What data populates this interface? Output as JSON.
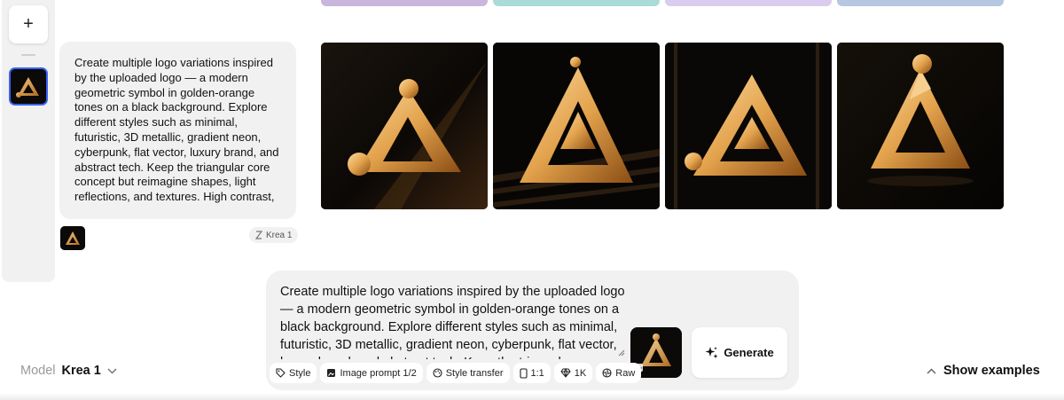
{
  "rail": {
    "add_label": "+"
  },
  "top_strips": [
    {
      "color": "#c9b6dd"
    },
    {
      "color": "#a9dcd6"
    },
    {
      "color": "#d9ccee"
    },
    {
      "color": "#b6c7e1"
    }
  ],
  "prompt": {
    "text": "Create multiple logo variations inspired by the uploaded logo — a modern geometric symbol in golden-orange tones on a black background. Explore different styles such as minimal, futuristic, 3D metallic, gradient neon, cyberpunk, flat vector, luxury brand, and abstract tech. Keep the triangular core concept but reimagine shapes, light reflections, and textures. High contrast,",
    "model_tag": "Krea 1"
  },
  "results": [
    {
      "name": "result-image-1"
    },
    {
      "name": "result-image-2"
    },
    {
      "name": "result-image-3"
    },
    {
      "name": "result-image-4"
    }
  ],
  "composer": {
    "text": "Create multiple logo variations inspired by the uploaded logo — a modern geometric symbol in golden-orange tones on a black background. Explore different styles such as minimal, futuristic, 3D metallic, gradient neon, cyberpunk, flat vector, luxury brand, and abstract tech. Keep the triangular core",
    "generate_label": "Generate",
    "chips": {
      "style": "Style",
      "image_prompt": "Image prompt 1/2",
      "style_transfer": "Style transfer",
      "aspect": "1:1",
      "resolution": "1K",
      "raw": "Raw"
    }
  },
  "footer": {
    "model_label": "Model",
    "model_name": "Krea 1",
    "show_examples": "Show examples"
  },
  "colors": {
    "accent_selected": "#3a63f3",
    "gold": "#e3a24c",
    "panel": "#f1f1f1"
  }
}
